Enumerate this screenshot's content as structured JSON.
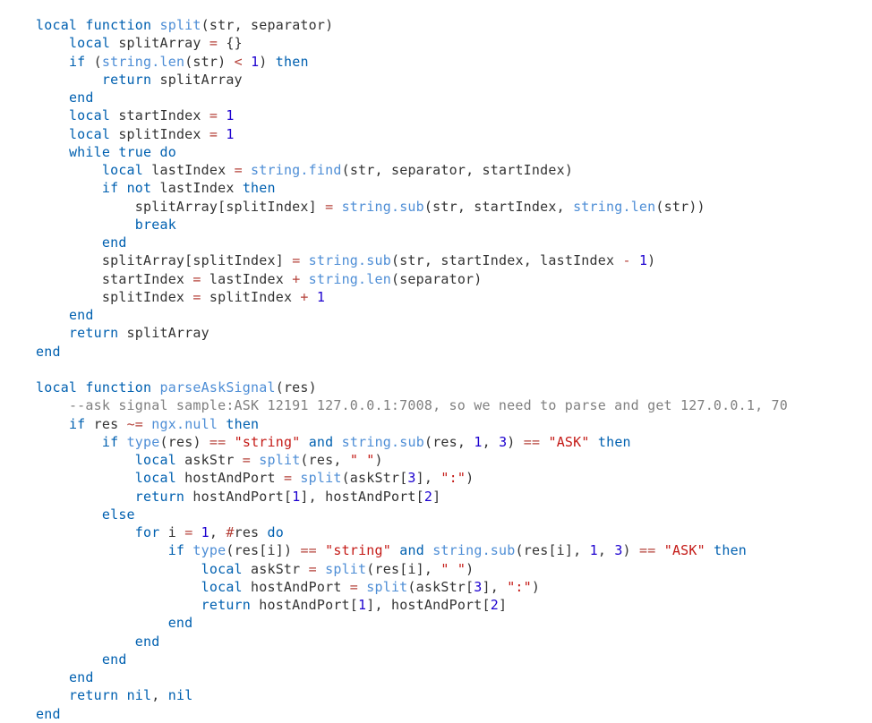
{
  "colors": {
    "keyword": "#0060b0",
    "function": "#1a70c2",
    "name": "#4e8ed6",
    "identifier": "#333333",
    "string": "#c41a16",
    "number": "#1c00cf",
    "operator": "#b5423a",
    "comment": "#808080",
    "background": "#ffffff"
  },
  "language": "lua",
  "tokens": [
    [
      [
        "kw",
        "local"
      ],
      [
        "id",
        " "
      ],
      [
        "kw",
        "function"
      ],
      [
        "id",
        " "
      ],
      [
        "nm",
        "split"
      ],
      [
        "pn",
        "("
      ],
      [
        "id",
        "str"
      ],
      [
        "pn",
        ", "
      ],
      [
        "id",
        "separator"
      ],
      [
        "pn",
        ")"
      ]
    ],
    [
      [
        "id",
        "    "
      ],
      [
        "kw",
        "local"
      ],
      [
        "id",
        " splitArray "
      ],
      [
        "op",
        "="
      ],
      [
        "id",
        " "
      ],
      [
        "pn",
        "{}"
      ]
    ],
    [
      [
        "id",
        "    "
      ],
      [
        "kw",
        "if"
      ],
      [
        "id",
        " "
      ],
      [
        "pn",
        "("
      ],
      [
        "nm",
        "string.len"
      ],
      [
        "pn",
        "("
      ],
      [
        "id",
        "str"
      ],
      [
        "pn",
        ")"
      ],
      [
        "id",
        " "
      ],
      [
        "op",
        "<"
      ],
      [
        "id",
        " "
      ],
      [
        "num",
        "1"
      ],
      [
        "pn",
        ")"
      ],
      [
        "id",
        " "
      ],
      [
        "kw",
        "then"
      ]
    ],
    [
      [
        "id",
        "        "
      ],
      [
        "kw",
        "return"
      ],
      [
        "id",
        " splitArray"
      ]
    ],
    [
      [
        "id",
        "    "
      ],
      [
        "kw",
        "end"
      ]
    ],
    [
      [
        "id",
        "    "
      ],
      [
        "kw",
        "local"
      ],
      [
        "id",
        " startIndex "
      ],
      [
        "op",
        "="
      ],
      [
        "id",
        " "
      ],
      [
        "num",
        "1"
      ]
    ],
    [
      [
        "id",
        "    "
      ],
      [
        "kw",
        "local"
      ],
      [
        "id",
        " splitIndex "
      ],
      [
        "op",
        "="
      ],
      [
        "id",
        " "
      ],
      [
        "num",
        "1"
      ]
    ],
    [
      [
        "id",
        "    "
      ],
      [
        "kw",
        "while"
      ],
      [
        "id",
        " "
      ],
      [
        "kw",
        "true"
      ],
      [
        "id",
        " "
      ],
      [
        "kw",
        "do"
      ]
    ],
    [
      [
        "id",
        "        "
      ],
      [
        "kw",
        "local"
      ],
      [
        "id",
        " lastIndex "
      ],
      [
        "op",
        "="
      ],
      [
        "id",
        " "
      ],
      [
        "nm",
        "string.find"
      ],
      [
        "pn",
        "("
      ],
      [
        "id",
        "str"
      ],
      [
        "pn",
        ", "
      ],
      [
        "id",
        "separator"
      ],
      [
        "pn",
        ", "
      ],
      [
        "id",
        "startIndex"
      ],
      [
        "pn",
        ")"
      ]
    ],
    [
      [
        "id",
        "        "
      ],
      [
        "kw",
        "if"
      ],
      [
        "id",
        " "
      ],
      [
        "kw",
        "not"
      ],
      [
        "id",
        " lastIndex "
      ],
      [
        "kw",
        "then"
      ]
    ],
    [
      [
        "id",
        "            "
      ],
      [
        "id",
        "splitArray"
      ],
      [
        "pn",
        "["
      ],
      [
        "id",
        "splitIndex"
      ],
      [
        "pn",
        "]"
      ],
      [
        "id",
        " "
      ],
      [
        "op",
        "="
      ],
      [
        "id",
        " "
      ],
      [
        "nm",
        "string.sub"
      ],
      [
        "pn",
        "("
      ],
      [
        "id",
        "str"
      ],
      [
        "pn",
        ", "
      ],
      [
        "id",
        "startIndex"
      ],
      [
        "pn",
        ", "
      ],
      [
        "nm",
        "string.len"
      ],
      [
        "pn",
        "("
      ],
      [
        "id",
        "str"
      ],
      [
        "pn",
        "))"
      ]
    ],
    [
      [
        "id",
        "            "
      ],
      [
        "kw",
        "break"
      ]
    ],
    [
      [
        "id",
        "        "
      ],
      [
        "kw",
        "end"
      ]
    ],
    [
      [
        "id",
        "        "
      ],
      [
        "id",
        "splitArray"
      ],
      [
        "pn",
        "["
      ],
      [
        "id",
        "splitIndex"
      ],
      [
        "pn",
        "]"
      ],
      [
        "id",
        " "
      ],
      [
        "op",
        "="
      ],
      [
        "id",
        " "
      ],
      [
        "nm",
        "string.sub"
      ],
      [
        "pn",
        "("
      ],
      [
        "id",
        "str"
      ],
      [
        "pn",
        ", "
      ],
      [
        "id",
        "startIndex"
      ],
      [
        "pn",
        ", "
      ],
      [
        "id",
        "lastIndex "
      ],
      [
        "op",
        "-"
      ],
      [
        "id",
        " "
      ],
      [
        "num",
        "1"
      ],
      [
        "pn",
        ")"
      ]
    ],
    [
      [
        "id",
        "        "
      ],
      [
        "id",
        "startIndex "
      ],
      [
        "op",
        "="
      ],
      [
        "id",
        " lastIndex "
      ],
      [
        "op",
        "+"
      ],
      [
        "id",
        " "
      ],
      [
        "nm",
        "string.len"
      ],
      [
        "pn",
        "("
      ],
      [
        "id",
        "separator"
      ],
      [
        "pn",
        ")"
      ]
    ],
    [
      [
        "id",
        "        "
      ],
      [
        "id",
        "splitIndex "
      ],
      [
        "op",
        "="
      ],
      [
        "id",
        " splitIndex "
      ],
      [
        "op",
        "+"
      ],
      [
        "id",
        " "
      ],
      [
        "num",
        "1"
      ]
    ],
    [
      [
        "id",
        "    "
      ],
      [
        "kw",
        "end"
      ]
    ],
    [
      [
        "id",
        "    "
      ],
      [
        "kw",
        "return"
      ],
      [
        "id",
        " splitArray"
      ]
    ],
    [
      [
        "kw",
        "end"
      ]
    ],
    [
      [
        "id",
        ""
      ]
    ],
    [
      [
        "kw",
        "local"
      ],
      [
        "id",
        " "
      ],
      [
        "kw",
        "function"
      ],
      [
        "id",
        " "
      ],
      [
        "nm",
        "parseAskSignal"
      ],
      [
        "pn",
        "("
      ],
      [
        "id",
        "res"
      ],
      [
        "pn",
        ")"
      ]
    ],
    [
      [
        "id",
        "    "
      ],
      [
        "cm",
        "--ask signal sample:ASK 12191 127.0.0.1:7008, so we need to parse and get 127.0.0.1, 70"
      ]
    ],
    [
      [
        "id",
        "    "
      ],
      [
        "kw",
        "if"
      ],
      [
        "id",
        " res "
      ],
      [
        "op",
        "~="
      ],
      [
        "id",
        " "
      ],
      [
        "nm",
        "ngx.null"
      ],
      [
        "id",
        " "
      ],
      [
        "kw",
        "then"
      ]
    ],
    [
      [
        "id",
        "        "
      ],
      [
        "kw",
        "if"
      ],
      [
        "id",
        " "
      ],
      [
        "nm",
        "type"
      ],
      [
        "pn",
        "("
      ],
      [
        "id",
        "res"
      ],
      [
        "pn",
        ")"
      ],
      [
        "id",
        " "
      ],
      [
        "op",
        "=="
      ],
      [
        "id",
        " "
      ],
      [
        "str",
        "\"string\""
      ],
      [
        "id",
        " "
      ],
      [
        "kw",
        "and"
      ],
      [
        "id",
        " "
      ],
      [
        "nm",
        "string.sub"
      ],
      [
        "pn",
        "("
      ],
      [
        "id",
        "res"
      ],
      [
        "pn",
        ", "
      ],
      [
        "num",
        "1"
      ],
      [
        "pn",
        ", "
      ],
      [
        "num",
        "3"
      ],
      [
        "pn",
        ")"
      ],
      [
        "id",
        " "
      ],
      [
        "op",
        "=="
      ],
      [
        "id",
        " "
      ],
      [
        "str",
        "\"ASK\""
      ],
      [
        "id",
        " "
      ],
      [
        "kw",
        "then"
      ]
    ],
    [
      [
        "id",
        "            "
      ],
      [
        "kw",
        "local"
      ],
      [
        "id",
        " askStr "
      ],
      [
        "op",
        "="
      ],
      [
        "id",
        " "
      ],
      [
        "nm",
        "split"
      ],
      [
        "pn",
        "("
      ],
      [
        "id",
        "res"
      ],
      [
        "pn",
        ", "
      ],
      [
        "str",
        "\" \""
      ],
      [
        "pn",
        ")"
      ]
    ],
    [
      [
        "id",
        "            "
      ],
      [
        "kw",
        "local"
      ],
      [
        "id",
        " hostAndPort "
      ],
      [
        "op",
        "="
      ],
      [
        "id",
        " "
      ],
      [
        "nm",
        "split"
      ],
      [
        "pn",
        "("
      ],
      [
        "id",
        "askStr"
      ],
      [
        "pn",
        "["
      ],
      [
        "num",
        "3"
      ],
      [
        "pn",
        "]"
      ],
      [
        "pn",
        ", "
      ],
      [
        "str",
        "\":\""
      ],
      [
        "pn",
        ")"
      ]
    ],
    [
      [
        "id",
        "            "
      ],
      [
        "kw",
        "return"
      ],
      [
        "id",
        " hostAndPort"
      ],
      [
        "pn",
        "["
      ],
      [
        "num",
        "1"
      ],
      [
        "pn",
        "]"
      ],
      [
        "pn",
        ", "
      ],
      [
        "id",
        "hostAndPort"
      ],
      [
        "pn",
        "["
      ],
      [
        "num",
        "2"
      ],
      [
        "pn",
        "]"
      ]
    ],
    [
      [
        "id",
        "        "
      ],
      [
        "kw",
        "else"
      ]
    ],
    [
      [
        "id",
        "            "
      ],
      [
        "kw",
        "for"
      ],
      [
        "id",
        " i "
      ],
      [
        "op",
        "="
      ],
      [
        "id",
        " "
      ],
      [
        "num",
        "1"
      ],
      [
        "pn",
        ", "
      ],
      [
        "op",
        "#"
      ],
      [
        "id",
        "res "
      ],
      [
        "kw",
        "do"
      ]
    ],
    [
      [
        "id",
        "                "
      ],
      [
        "kw",
        "if"
      ],
      [
        "id",
        " "
      ],
      [
        "nm",
        "type"
      ],
      [
        "pn",
        "("
      ],
      [
        "id",
        "res"
      ],
      [
        "pn",
        "["
      ],
      [
        "id",
        "i"
      ],
      [
        "pn",
        "])"
      ],
      [
        "id",
        " "
      ],
      [
        "op",
        "=="
      ],
      [
        "id",
        " "
      ],
      [
        "str",
        "\"string\""
      ],
      [
        "id",
        " "
      ],
      [
        "kw",
        "and"
      ],
      [
        "id",
        " "
      ],
      [
        "nm",
        "string.sub"
      ],
      [
        "pn",
        "("
      ],
      [
        "id",
        "res"
      ],
      [
        "pn",
        "["
      ],
      [
        "id",
        "i"
      ],
      [
        "pn",
        "]"
      ],
      [
        "pn",
        ", "
      ],
      [
        "num",
        "1"
      ],
      [
        "pn",
        ", "
      ],
      [
        "num",
        "3"
      ],
      [
        "pn",
        ")"
      ],
      [
        "id",
        " "
      ],
      [
        "op",
        "=="
      ],
      [
        "id",
        " "
      ],
      [
        "str",
        "\"ASK\""
      ],
      [
        "id",
        " "
      ],
      [
        "kw",
        "then"
      ]
    ],
    [
      [
        "id",
        "                    "
      ],
      [
        "kw",
        "local"
      ],
      [
        "id",
        " askStr "
      ],
      [
        "op",
        "="
      ],
      [
        "id",
        " "
      ],
      [
        "nm",
        "split"
      ],
      [
        "pn",
        "("
      ],
      [
        "id",
        "res"
      ],
      [
        "pn",
        "["
      ],
      [
        "id",
        "i"
      ],
      [
        "pn",
        "]"
      ],
      [
        "pn",
        ", "
      ],
      [
        "str",
        "\" \""
      ],
      [
        "pn",
        ")"
      ]
    ],
    [
      [
        "id",
        "                    "
      ],
      [
        "kw",
        "local"
      ],
      [
        "id",
        " hostAndPort "
      ],
      [
        "op",
        "="
      ],
      [
        "id",
        " "
      ],
      [
        "nm",
        "split"
      ],
      [
        "pn",
        "("
      ],
      [
        "id",
        "askStr"
      ],
      [
        "pn",
        "["
      ],
      [
        "num",
        "3"
      ],
      [
        "pn",
        "]"
      ],
      [
        "pn",
        ", "
      ],
      [
        "str",
        "\":\""
      ],
      [
        "pn",
        ")"
      ]
    ],
    [
      [
        "id",
        "                    "
      ],
      [
        "kw",
        "return"
      ],
      [
        "id",
        " hostAndPort"
      ],
      [
        "pn",
        "["
      ],
      [
        "num",
        "1"
      ],
      [
        "pn",
        "]"
      ],
      [
        "pn",
        ", "
      ],
      [
        "id",
        "hostAndPort"
      ],
      [
        "pn",
        "["
      ],
      [
        "num",
        "2"
      ],
      [
        "pn",
        "]"
      ]
    ],
    [
      [
        "id",
        "                "
      ],
      [
        "kw",
        "end"
      ]
    ],
    [
      [
        "id",
        "            "
      ],
      [
        "kw",
        "end"
      ]
    ],
    [
      [
        "id",
        "        "
      ],
      [
        "kw",
        "end"
      ]
    ],
    [
      [
        "id",
        "    "
      ],
      [
        "kw",
        "end"
      ]
    ],
    [
      [
        "id",
        "    "
      ],
      [
        "kw",
        "return"
      ],
      [
        "id",
        " "
      ],
      [
        "kw",
        "nil"
      ],
      [
        "pn",
        ", "
      ],
      [
        "kw",
        "nil"
      ]
    ],
    [
      [
        "kw",
        "end"
      ]
    ]
  ]
}
